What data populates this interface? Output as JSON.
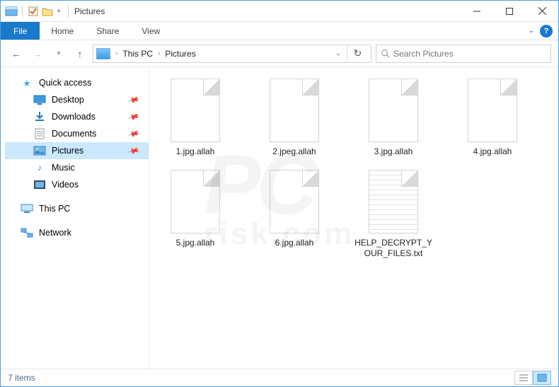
{
  "window": {
    "title": "Pictures"
  },
  "ribbon": {
    "file": "File",
    "tabs": [
      "Home",
      "Share",
      "View"
    ]
  },
  "breadcrumb": {
    "items": [
      "This PC",
      "Pictures"
    ]
  },
  "search": {
    "placeholder": "Search Pictures"
  },
  "sidebar": {
    "quick_access": "Quick access",
    "items": [
      {
        "label": "Desktop",
        "icon": "desktop",
        "pinned": true
      },
      {
        "label": "Downloads",
        "icon": "downloads",
        "pinned": true
      },
      {
        "label": "Documents",
        "icon": "documents",
        "pinned": true
      },
      {
        "label": "Pictures",
        "icon": "pictures",
        "pinned": true,
        "selected": true
      },
      {
        "label": "Music",
        "icon": "music",
        "pinned": false
      },
      {
        "label": "Videos",
        "icon": "videos",
        "pinned": false
      }
    ],
    "this_pc": "This PC",
    "network": "Network"
  },
  "files": [
    {
      "name": "1.jpg.allah",
      "type": "file"
    },
    {
      "name": "2.jpeg.allah",
      "type": "file"
    },
    {
      "name": "3.jpg.allah",
      "type": "file"
    },
    {
      "name": "4.jpg.allah",
      "type": "file"
    },
    {
      "name": "5.jpg.allah",
      "type": "file"
    },
    {
      "name": "6.jpg.allah",
      "type": "file"
    },
    {
      "name": "HELP_DECRYPT_YOUR_FILES.txt",
      "type": "txt"
    }
  ],
  "status": {
    "count_text": "7 items"
  },
  "watermark": {
    "main": "PC",
    "sub": "risk.com"
  }
}
